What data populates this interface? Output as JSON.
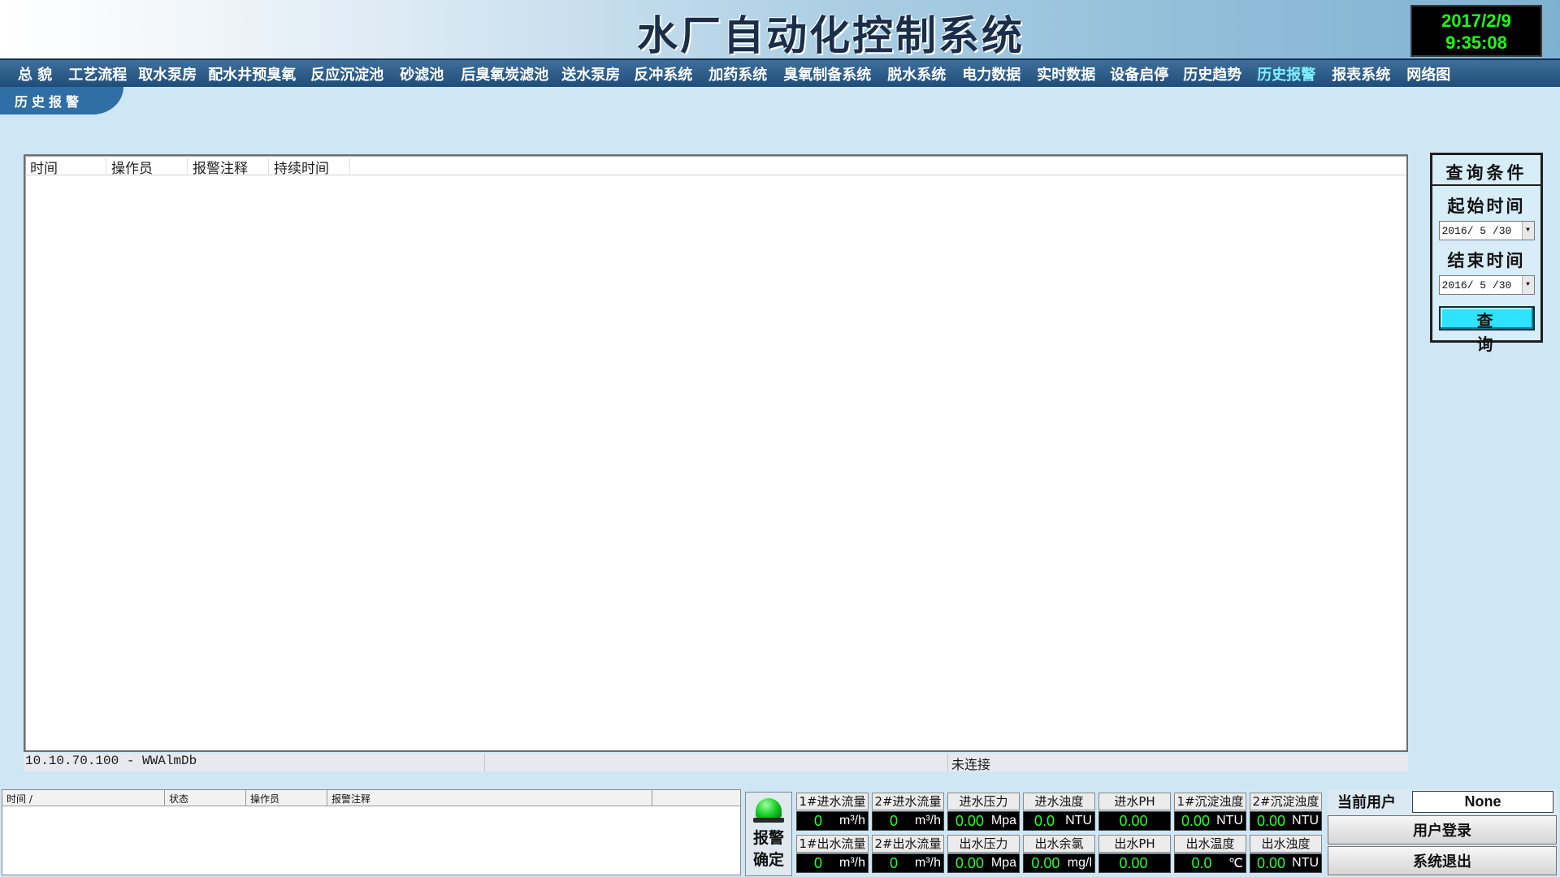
{
  "header": {
    "title": "水厂自动化控制系统",
    "date": "2017/2/9",
    "time": "9:35:08"
  },
  "nav": {
    "items": [
      "总 貌",
      "工艺流程",
      "取水泵房",
      "配水井预臭氧",
      "反应沉淀池",
      "砂滤池",
      "后臭氧炭滤池",
      "送水泵房",
      "反冲系统",
      "加药系统",
      "臭氧制备系统",
      "脱水系统",
      "电力数据",
      "实时数据",
      "设备启停",
      "历史趋势",
      "历史报警",
      "报表系统",
      "网络图"
    ],
    "active": "历史报警"
  },
  "page_tab": "历史报警",
  "alarm_grid": {
    "columns": [
      "时间",
      "操作员",
      "报警注释",
      "持续时间"
    ]
  },
  "statusbar": {
    "connection": "10.10.70.100 - WWAlmDb",
    "middle": "",
    "state": "未连接"
  },
  "query": {
    "title": "查询条件",
    "start_label": "起始时间",
    "start_value": "2016/ 5 /30",
    "end_label": "结束时间",
    "end_value": "2016/ 5 /30",
    "button": "查 询"
  },
  "event_list": {
    "columns": [
      "时间 /",
      "状态",
      "操作员",
      "报警注释"
    ]
  },
  "ack": {
    "line1": "报警",
    "line2": "确定"
  },
  "readings": [
    {
      "label": "1#进水流量",
      "value": "0",
      "unit": "m³/h"
    },
    {
      "label": "2#进水流量",
      "value": "0",
      "unit": "m³/h"
    },
    {
      "label": "进水压力",
      "value": "0.00",
      "unit": "Mpa"
    },
    {
      "label": "进水浊度",
      "value": "0.0",
      "unit": "NTU"
    },
    {
      "label": "进水PH",
      "value": "0.00",
      "unit": ""
    },
    {
      "label": "1#沉淀浊度",
      "value": "0.00",
      "unit": "NTU"
    },
    {
      "label": "2#沉淀浊度",
      "value": "0.00",
      "unit": "NTU"
    },
    {
      "label": "1#出水流量",
      "value": "0",
      "unit": "m³/h"
    },
    {
      "label": "2#出水流量",
      "value": "0",
      "unit": "m³/h"
    },
    {
      "label": "出水压力",
      "value": "0.00",
      "unit": "Mpa"
    },
    {
      "label": "出水余氯",
      "value": "0.00",
      "unit": "mg/l"
    },
    {
      "label": "出水PH",
      "value": "0.00",
      "unit": ""
    },
    {
      "label": "出水温度",
      "value": "0.0",
      "unit": "℃"
    },
    {
      "label": "出水浊度",
      "value": "0.00",
      "unit": "NTU"
    }
  ],
  "user": {
    "label": "当前用户",
    "value": "None",
    "login": "用户登录",
    "logout": "系统退出"
  },
  "colors": {
    "accent": "#2ee3ff",
    "nav_active": "#7ff0ff",
    "clock_text": "#19ff19",
    "siren": "#11cc22"
  }
}
